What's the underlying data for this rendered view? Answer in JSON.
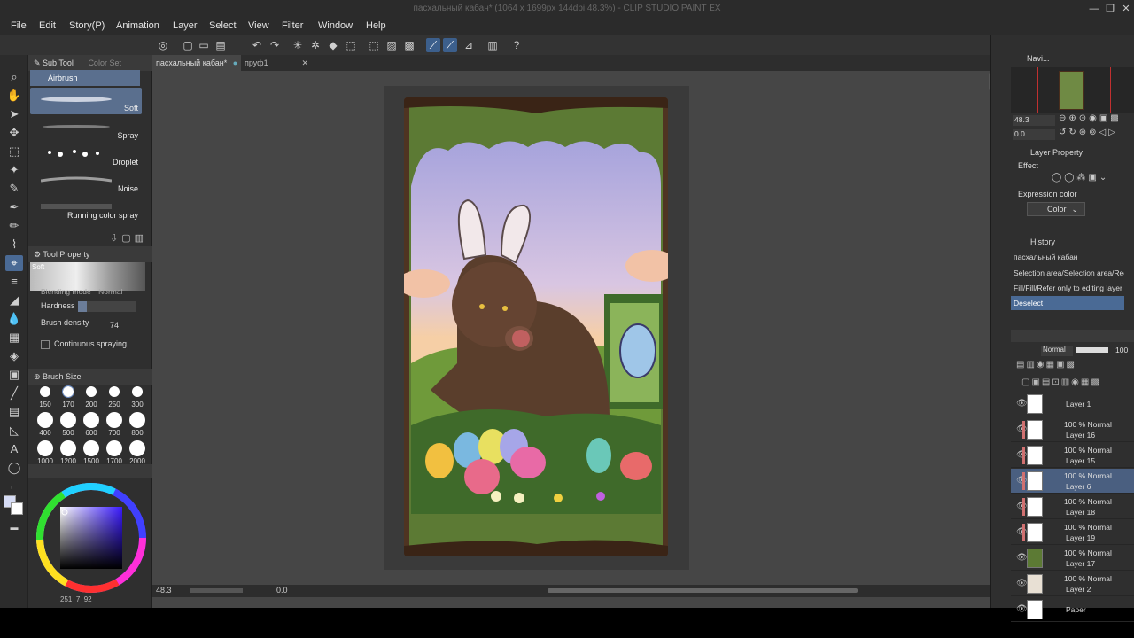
{
  "window": {
    "title": "пасхальный кабан* (1064 x 1699px 144dpi 48.3%) - CLIP STUDIO PAINT EX",
    "minimize": "—",
    "maximize": "❐",
    "close": "✕"
  },
  "menu": [
    "File",
    "Edit",
    "Story(P)",
    "Animation",
    "Layer",
    "Select",
    "View",
    "Filter",
    "Window",
    "Help"
  ],
  "tabs": [
    {
      "label": "пасхальный кабан*",
      "close": "●"
    },
    {
      "label": "пруф1",
      "close": "✕"
    }
  ],
  "subtool": {
    "title": "Sub Tool",
    "tab2": "Color Set",
    "selected": "Airbrush",
    "brushes": [
      {
        "label": "Soft"
      },
      {
        "label": "Spray"
      },
      {
        "label": "Droplet"
      },
      {
        "label": "Noise"
      },
      {
        "label": "Running color spray"
      }
    ]
  },
  "toolprop": {
    "title": "Tool Property",
    "preview_label": "Soft",
    "blend_label": "Blending mode",
    "blend_value": "Normal",
    "hardness_label": "Hardness",
    "density_label": "Brush density",
    "density_value": "74",
    "continuous_label": "Continuous spraying"
  },
  "brushsize": {
    "title": "Brush Size",
    "sizes": [
      "150",
      "170",
      "200",
      "250",
      "300",
      "400",
      "500",
      "600",
      "700",
      "800",
      "1000",
      "1200",
      "1500",
      "1700",
      "2000"
    ],
    "selected": "170"
  },
  "color": {
    "main": "#d6dcf5",
    "sub": "#ffffff",
    "values": [
      "251",
      "7",
      "92"
    ]
  },
  "statusbar": {
    "zoom": "48.3",
    "angle": "0.0"
  },
  "navigator": {
    "title": "Navi...",
    "zoom": "48.3",
    "angle": "0.0"
  },
  "layer_property": {
    "title": "Layer Property",
    "effect_label": "Effect",
    "expression_label": "Expression color",
    "expression_value": "Color"
  },
  "history": {
    "title": "History",
    "items": [
      "пасхальный кабан",
      "Selection area/Selection area/Rectangle",
      "Fill/Fill/Refer only to editing layer",
      "Deselect"
    ]
  },
  "layers": {
    "blend": "Normal",
    "opacity": "100",
    "items": [
      {
        "name": "Layer 1",
        "mode": ""
      },
      {
        "name": "Layer 16",
        "mode": "100 % Normal"
      },
      {
        "name": "Layer 15",
        "mode": "100 % Normal"
      },
      {
        "name": "Layer 6",
        "mode": "100 % Normal"
      },
      {
        "name": "Layer 18",
        "mode": "100 % Normal"
      },
      {
        "name": "Layer 19",
        "mode": "100 % Normal"
      },
      {
        "name": "Layer 17",
        "mode": "100 % Normal"
      },
      {
        "name": "Layer 2",
        "mode": "100 % Normal"
      },
      {
        "name": "Paper",
        "mode": ""
      }
    ]
  }
}
